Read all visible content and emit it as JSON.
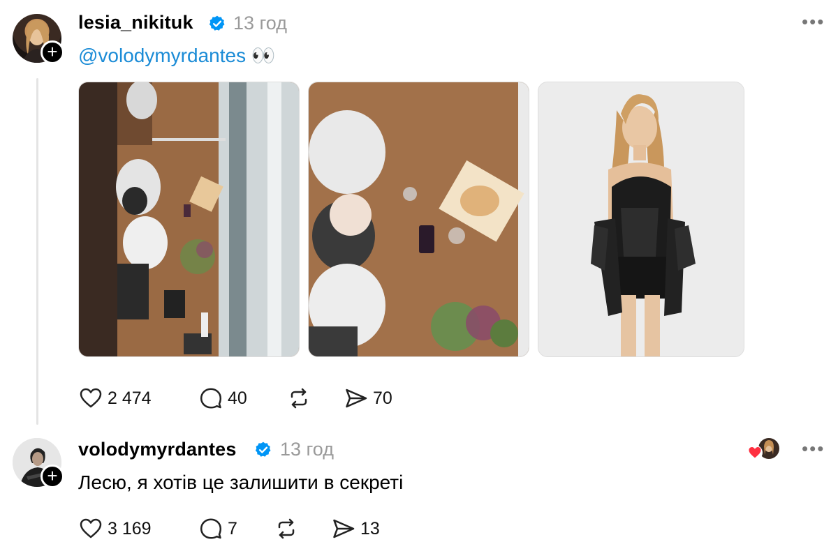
{
  "post": {
    "username": "lesia_nikituk",
    "time": "13 год",
    "text": {
      "mention": "@volodymyrdantes",
      "emoji": "👀"
    },
    "media": [
      {
        "name": "photo-overhead-table-1"
      },
      {
        "name": "photo-overhead-table-2"
      },
      {
        "name": "photo-woman-black-corset"
      }
    ],
    "actions": {
      "likes": "2 474",
      "comments": "40",
      "shares": "70"
    }
  },
  "reply": {
    "username": "volodymyrdantes",
    "time": "13 год",
    "text": "Лесю, я хотів це залишити в секреті",
    "actions": {
      "likes": "3 169",
      "comments": "7",
      "shares": "13"
    }
  },
  "colors": {
    "verified": "#0095f6",
    "mention": "#1a8bd6",
    "like_badge": "#ff3040"
  },
  "icons": [
    "heart-icon",
    "comment-icon",
    "repost-icon",
    "share-icon",
    "verified-icon",
    "more-icon",
    "plus-icon"
  ]
}
